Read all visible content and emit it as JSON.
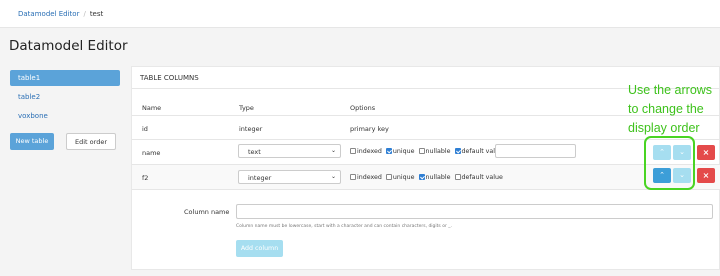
{
  "breadcrumb": {
    "root": "Datamodel Editor",
    "sep": "/",
    "current": "test"
  },
  "page_title": "Datamodel Editor",
  "sidebar": {
    "tables": [
      {
        "label": "table1",
        "active": true
      },
      {
        "label": "table2",
        "active": false
      },
      {
        "label": "voxbone",
        "active": false
      }
    ],
    "new_table": "New table",
    "edit_order": "Edit order"
  },
  "panel": {
    "title": "TABLE COLUMNS",
    "headers": {
      "name": "Name",
      "type": "Type",
      "options": "Options"
    },
    "rows": [
      {
        "name": "id",
        "type": "integer",
        "options_text": "primary key"
      },
      {
        "name": "name",
        "type": "text",
        "indexed": false,
        "unique": true,
        "nullable": false,
        "default": true
      },
      {
        "name": "f2",
        "type": "integer",
        "indexed": false,
        "unique": false,
        "nullable": true,
        "default": false
      }
    ],
    "option_labels": {
      "indexed": "indexed",
      "unique": "unique",
      "nullable": "nullable",
      "default": "default value"
    }
  },
  "annotation": "Use the arrows to change the display order",
  "form": {
    "column_name_label": "Column name",
    "hint": "Column name must be lowercase, start with a character and can contain characters, digits or _.",
    "add_button": "Add column"
  },
  "icons": {
    "up": "chevron-up-icon",
    "down": "chevron-down-icon",
    "delete": "close-icon",
    "select_caret": "chevron-down-icon"
  },
  "colors": {
    "accent": "#5ba3d9",
    "arrow_light": "#a6def0",
    "arrow_active": "#3c9ed8",
    "danger": "#e44a4a",
    "annotation": "#3ec21c"
  }
}
